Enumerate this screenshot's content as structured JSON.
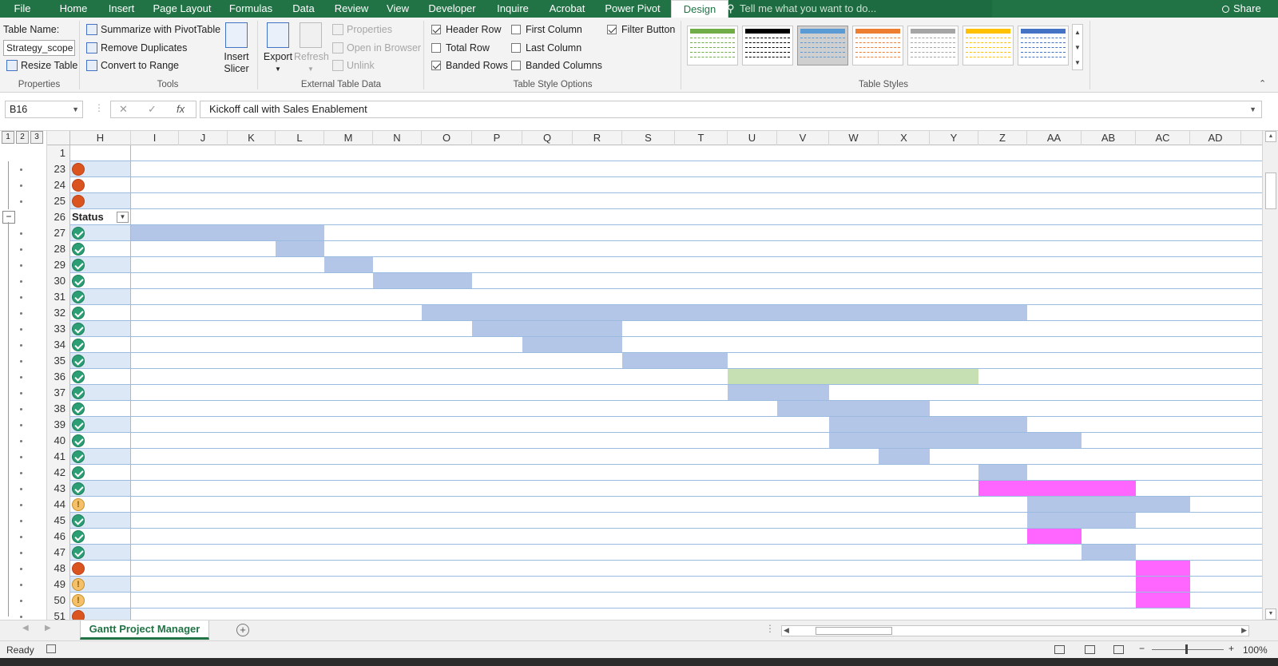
{
  "ribbon_tabs": [
    "File",
    "Home",
    "Insert",
    "Page Layout",
    "Formulas",
    "Data",
    "Review",
    "View",
    "Developer",
    "Inquire",
    "Acrobat",
    "Power Pivot",
    "Design"
  ],
  "active_tab": "Design",
  "tell_me_placeholder": "Tell me what you want to do...",
  "share_label": "Share",
  "properties": {
    "table_name_label": "Table Name:",
    "table_name_value": "Strategy_scope",
    "resize_label": "Resize Table",
    "group_label": "Properties"
  },
  "tools": {
    "summarize": "Summarize with PivotTable",
    "remove_dup": "Remove Duplicates",
    "convert": "Convert to Range",
    "insert_slicer_1": "Insert",
    "insert_slicer_2": "Slicer",
    "group_label": "Tools"
  },
  "external": {
    "export": "Export",
    "refresh": "Refresh",
    "properties": "Properties",
    "open_browser": "Open in Browser",
    "unlink": "Unlink",
    "group_label": "External Table Data"
  },
  "style_options": {
    "header_row": "Header Row",
    "total_row": "Total Row",
    "banded_rows": "Banded Rows",
    "first_column": "First Column",
    "last_column": "Last Column",
    "banded_columns": "Banded Columns",
    "filter_button": "Filter Button",
    "group_label": "Table Style Options"
  },
  "table_styles": {
    "group_label": "Table Styles",
    "colors": [
      "#70ad47",
      "#000000",
      "#5b9bd5",
      "#ed7d31",
      "#a5a5a5",
      "#ffc000",
      "#4472c4"
    ]
  },
  "formula_bar": {
    "cell_ref": "B16",
    "fx_label": "fx",
    "formula": "Kickoff call with Sales Enablement"
  },
  "columns": [
    "H",
    "I",
    "J",
    "K",
    "L",
    "M",
    "N",
    "O",
    "P",
    "Q",
    "R",
    "S",
    "T",
    "U",
    "V",
    "W",
    "X",
    "Y",
    "Z",
    "AA",
    "AB",
    "AC",
    "AD"
  ],
  "outline_levels": [
    "1",
    "2",
    "3"
  ],
  "status_header": "Status",
  "rows": [
    {
      "num": "1",
      "status": ""
    },
    {
      "num": "23",
      "status": "red"
    },
    {
      "num": "24",
      "status": "red"
    },
    {
      "num": "25",
      "status": "red"
    },
    {
      "num": "26",
      "status": "header"
    },
    {
      "num": "27",
      "status": "ok"
    },
    {
      "num": "28",
      "status": "ok"
    },
    {
      "num": "29",
      "status": "ok"
    },
    {
      "num": "30",
      "status": "ok"
    },
    {
      "num": "31",
      "status": "ok"
    },
    {
      "num": "32",
      "status": "ok"
    },
    {
      "num": "33",
      "status": "ok"
    },
    {
      "num": "34",
      "status": "ok"
    },
    {
      "num": "35",
      "status": "ok"
    },
    {
      "num": "36",
      "status": "ok"
    },
    {
      "num": "37",
      "status": "ok"
    },
    {
      "num": "38",
      "status": "ok"
    },
    {
      "num": "39",
      "status": "ok"
    },
    {
      "num": "40",
      "status": "ok"
    },
    {
      "num": "41",
      "status": "ok"
    },
    {
      "num": "42",
      "status": "ok"
    },
    {
      "num": "43",
      "status": "ok"
    },
    {
      "num": "44",
      "status": "warn"
    },
    {
      "num": "45",
      "status": "ok"
    },
    {
      "num": "46",
      "status": "ok"
    },
    {
      "num": "47",
      "status": "ok"
    },
    {
      "num": "48",
      "status": "red"
    },
    {
      "num": "49",
      "status": "warn"
    },
    {
      "num": "50",
      "status": "warn"
    },
    {
      "num": "51",
      "status": "red"
    }
  ],
  "gantt_bars": [
    {
      "row": "27",
      "from": "I",
      "to": "L",
      "color": "#b4c6e7"
    },
    {
      "row": "28",
      "from": "L",
      "to": "L",
      "color": "#b4c6e7"
    },
    {
      "row": "29",
      "from": "M",
      "to": "M",
      "color": "#b4c6e7"
    },
    {
      "row": "30",
      "from": "N",
      "to": "O",
      "color": "#b4c6e7"
    },
    {
      "row": "32",
      "from": "O",
      "to": "Z",
      "color": "#b4c6e7"
    },
    {
      "row": "33",
      "from": "P",
      "to": "R",
      "color": "#b4c6e7"
    },
    {
      "row": "34",
      "from": "Q",
      "to": "R",
      "color": "#b4c6e7"
    },
    {
      "row": "35",
      "from": "S",
      "to": "T",
      "color": "#b4c6e7"
    },
    {
      "row": "36",
      "from": "U",
      "to": "Y",
      "color": "#c6e0b4"
    },
    {
      "row": "37",
      "from": "U",
      "to": "V",
      "color": "#b4c6e7"
    },
    {
      "row": "38",
      "from": "V",
      "to": "X",
      "color": "#b4c6e7"
    },
    {
      "row": "39",
      "from": "W",
      "to": "Z",
      "color": "#b4c6e7"
    },
    {
      "row": "40",
      "from": "W",
      "to": "AA",
      "color": "#b4c6e7"
    },
    {
      "row": "41",
      "from": "X",
      "to": "X",
      "color": "#b4c6e7"
    },
    {
      "row": "42",
      "from": "Z",
      "to": "Z",
      "color": "#b4c6e7"
    },
    {
      "row": "43",
      "from": "Z",
      "to": "AB",
      "color": "#ff66ff"
    },
    {
      "row": "44",
      "from": "AA",
      "to": "AC",
      "color": "#b4c6e7"
    },
    {
      "row": "45",
      "from": "AA",
      "to": "AB",
      "color": "#b4c6e7"
    },
    {
      "row": "46",
      "from": "AA",
      "to": "AA",
      "color": "#ff66ff"
    },
    {
      "row": "47",
      "from": "AB",
      "to": "AB",
      "color": "#b4c6e7"
    },
    {
      "row": "48",
      "from": "AC",
      "to": "AC",
      "color": "#ff66ff"
    },
    {
      "row": "49",
      "from": "AC",
      "to": "AC",
      "color": "#ff66ff"
    },
    {
      "row": "50",
      "from": "AC",
      "to": "AC",
      "color": "#ff66ff"
    }
  ],
  "sheet_tab": "Gantt Project Manager",
  "status_bar": {
    "ready": "Ready",
    "zoom": "100%"
  }
}
